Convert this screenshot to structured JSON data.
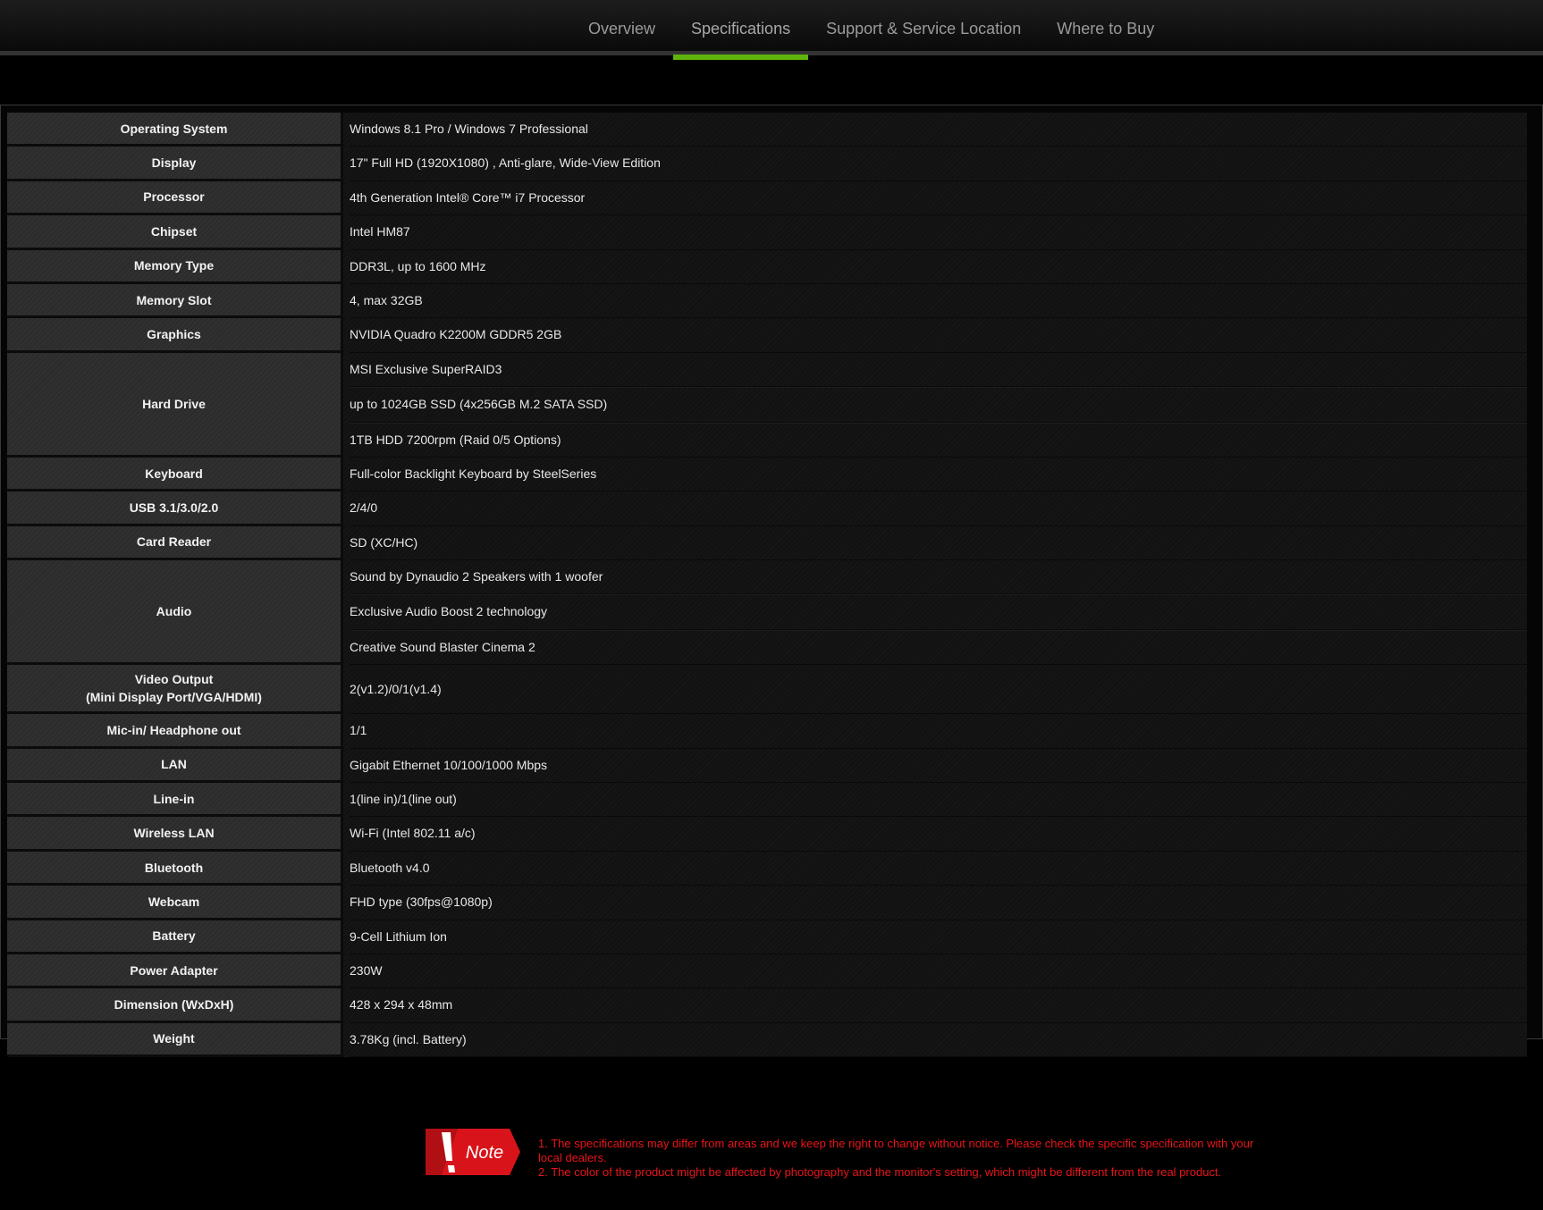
{
  "nav": {
    "tabs": [
      "Overview",
      "Specifications",
      "Support & Service Location",
      "Where to Buy"
    ],
    "active_tab": "Specifications",
    "accent_color": "#5fb40b"
  },
  "specs": [
    {
      "label": "Operating System",
      "values": [
        "Windows 8.1 Pro / Windows 7 Professional"
      ]
    },
    {
      "label": "Display",
      "values": [
        "17\" Full HD (1920X1080) , Anti-glare, Wide-View Edition"
      ]
    },
    {
      "label": "Processor",
      "values": [
        "4th Generation Intel® Core™ i7 Processor"
      ]
    },
    {
      "label": "Chipset",
      "values": [
        "Intel HM87"
      ]
    },
    {
      "label": "Memory Type",
      "values": [
        "DDR3L, up to 1600 MHz"
      ]
    },
    {
      "label": "Memory Slot",
      "values": [
        "4, max 32GB"
      ]
    },
    {
      "label": "Graphics",
      "values": [
        "NVIDIA Quadro K2200M GDDR5 2GB"
      ]
    },
    {
      "label": "Hard Drive",
      "values": [
        "MSI Exclusive SuperRAID3",
        "up to 1024GB SSD (4x256GB M.2 SATA SSD)",
        "1TB HDD 7200rpm (Raid 0/5 Options)"
      ]
    },
    {
      "label": "Keyboard",
      "values": [
        "Full-color Backlight Keyboard by SteelSeries"
      ]
    },
    {
      "label": "USB 3.1/3.0/2.0",
      "values": [
        "2/4/0"
      ]
    },
    {
      "label": "Card Reader",
      "values": [
        "SD (XC/HC)"
      ]
    },
    {
      "label": "Audio",
      "values": [
        "Sound by Dynaudio 2 Speakers with 1 woofer",
        "Exclusive Audio Boost 2 technology",
        "Creative Sound Blaster Cinema 2"
      ]
    },
    {
      "label": "Video Output",
      "sublabel": "(Mini Display Port/VGA/HDMI)",
      "values": [
        "2(v1.2)/0/1(v1.4)"
      ]
    },
    {
      "label": "Mic-in/ Headphone out",
      "values": [
        "1/1"
      ]
    },
    {
      "label": "LAN",
      "values": [
        "Gigabit Ethernet 10/100/1000 Mbps"
      ]
    },
    {
      "label": "Line-in",
      "values": [
        "1(line in)/1(line out)"
      ]
    },
    {
      "label": "Wireless LAN",
      "values": [
        "Wi-Fi (Intel 802.11 a/c)"
      ]
    },
    {
      "label": "Bluetooth",
      "values": [
        "Bluetooth v4.0"
      ]
    },
    {
      "label": "Webcam",
      "values": [
        "FHD type (30fps@1080p)"
      ]
    },
    {
      "label": "Battery",
      "values": [
        "9-Cell Lithium Ion"
      ]
    },
    {
      "label": "Power Adapter",
      "values": [
        "230W"
      ]
    },
    {
      "label": "Dimension (WxDxH)",
      "values": [
        "428 x 294 x 48mm"
      ]
    },
    {
      "label": "Weight",
      "values": [
        "3.78Kg (incl. Battery)"
      ]
    }
  ],
  "note": {
    "badge_label": "Note",
    "badge_color": "#d8141a",
    "text_color": "#e8141a",
    "lines": [
      "1. The specifications may differ from areas and we keep the right to change without notice. Please check the specific specification with your local dealers.",
      "2. The color of the product might be affected by photography and the monitor's setting, which might be different from the real product."
    ]
  }
}
